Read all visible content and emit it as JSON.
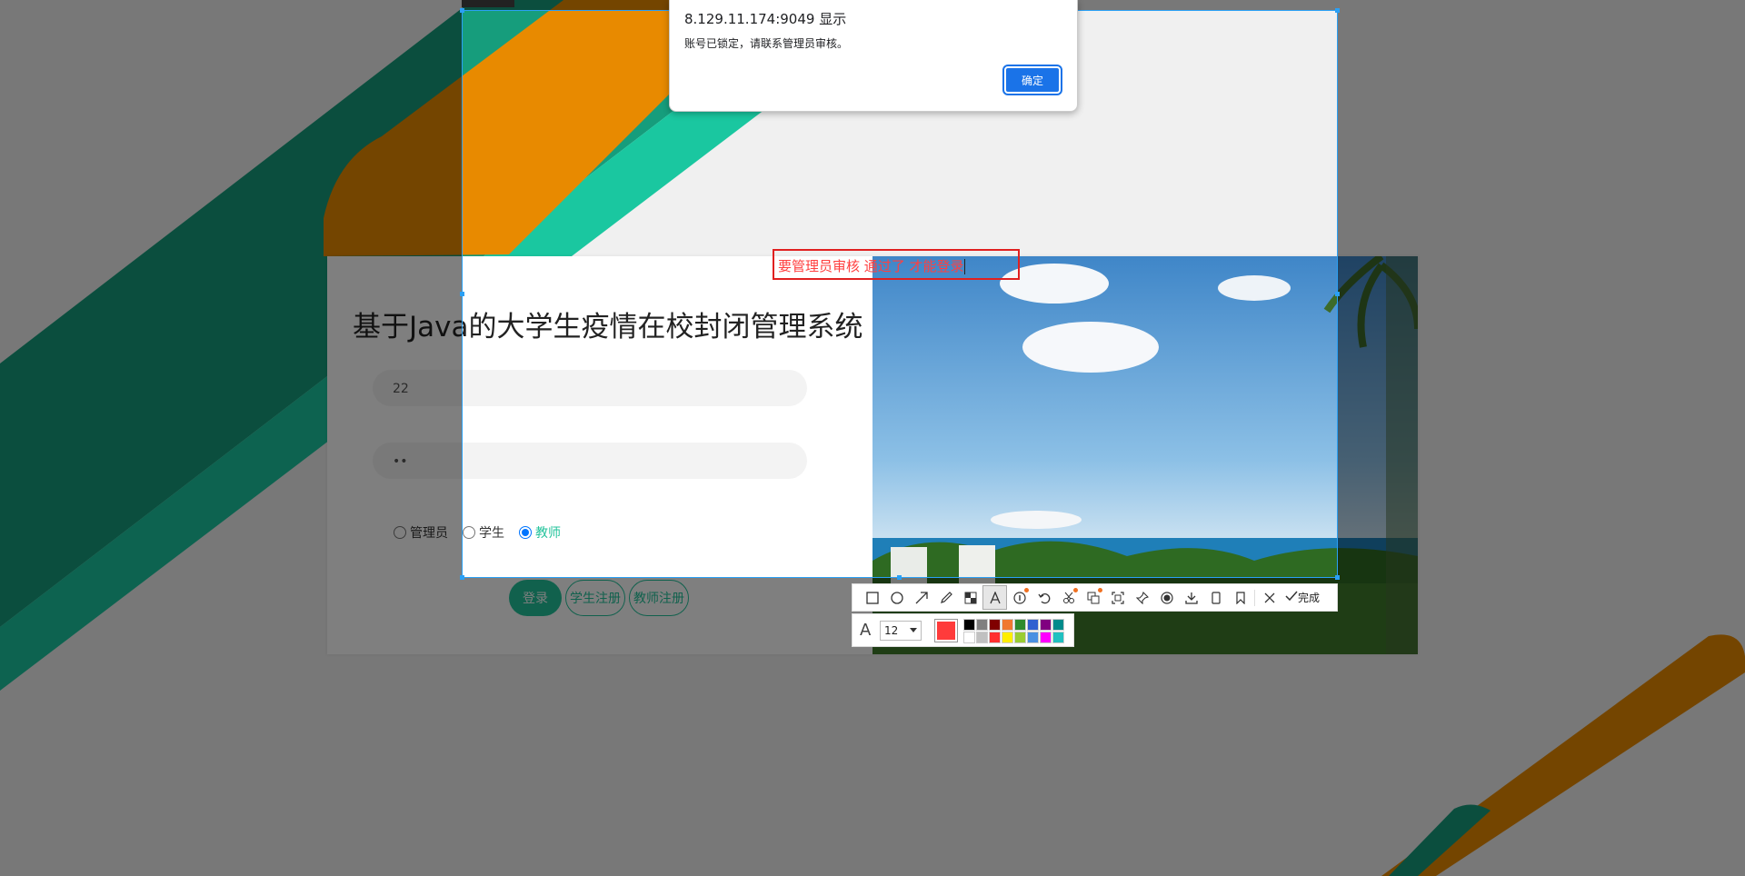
{
  "login": {
    "title": "基于Java的大学生疫情在校封闭管理系统",
    "username_value": "22",
    "password_value": "••",
    "roles": [
      "管理员",
      "学生",
      "教师"
    ],
    "selected_role": "教师",
    "login_button": "登录",
    "student_register_button": "学生注册",
    "teacher_register_button": "教师注册"
  },
  "alert": {
    "origin": "8.129.11.174:9049 显示",
    "message": "账号已锁定，请联系管理员审核。",
    "ok_label": "确定"
  },
  "annotation": {
    "text": "要管理员审核 通过了 才能登录"
  },
  "screenshot_tool": {
    "done_label": "完成",
    "font_size": "12",
    "current_color": "#ff3b3b",
    "palette": [
      "#000000",
      "#808080",
      "#800000",
      "#f07830",
      "#2e8b2e",
      "#3060d0",
      "#800080",
      "#008b8b",
      "#ffffff",
      "#c0c0c0",
      "#ff3030",
      "#ffee00",
      "#9acd32",
      "#4a90e2",
      "#ff00ff",
      "#20c0c0"
    ],
    "icons": [
      "rectangle-icon",
      "ellipse-icon",
      "arrow-icon",
      "pencil-icon",
      "mosaic-icon",
      "text-icon",
      "serial-number-icon",
      "undo-icon",
      "ocr-icon",
      "translate-icon",
      "scroll-capture-icon",
      "pin-icon",
      "record-icon",
      "save-icon",
      "long-screenshot-icon",
      "bookmark-icon",
      "close-icon",
      "done-icon"
    ]
  },
  "colors": {
    "accent_green": "#23c39b",
    "orange": "#e88a00",
    "teal": "#1e9e7e",
    "selection_blue": "#2aa0f5",
    "annotation_red": "#e02020"
  }
}
